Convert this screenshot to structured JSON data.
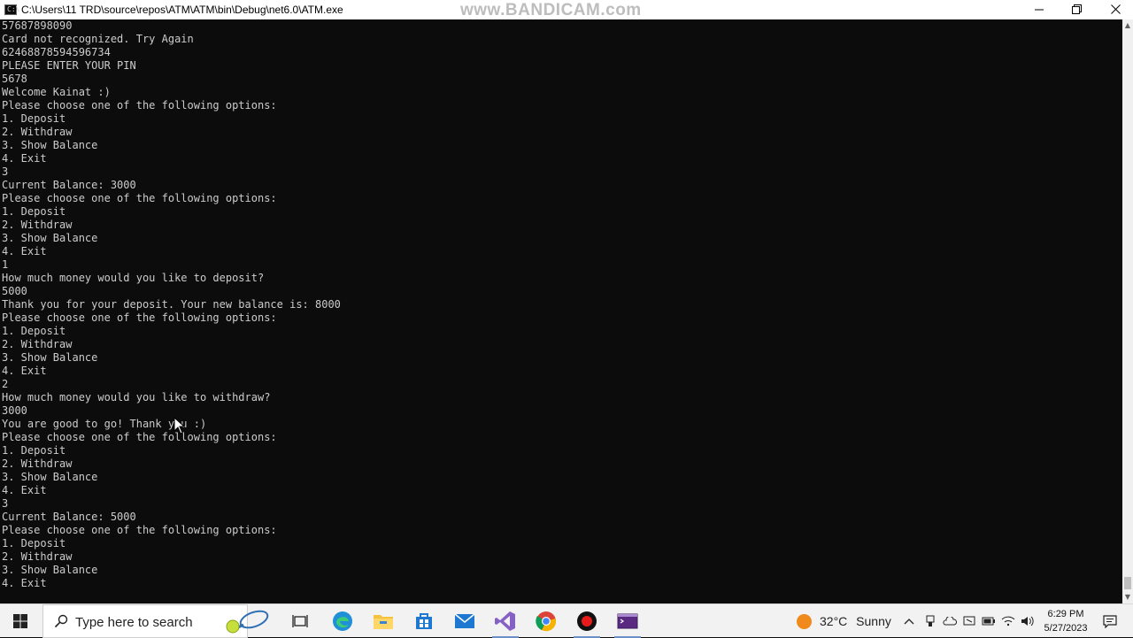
{
  "window": {
    "title": "C:\\Users\\11 TRD\\source\\repos\\ATM\\ATM\\bin\\Debug\\net6.0\\ATM.exe",
    "watermark": "www.BANDICAM.com",
    "minimize_icon": "minimize-icon",
    "restore_icon": "restore-icon",
    "close_icon": "close-icon"
  },
  "console": {
    "lines": [
      "57687898090",
      "Card not recognized. Try Again",
      "62468878594596734",
      "PLEASE ENTER YOUR PIN",
      "5678",
      "Welcome Kainat :)",
      "Please choose one of the following options:",
      "1. Deposit",
      "2. Withdraw",
      "3. Show Balance",
      "4. Exit",
      "3",
      "Current Balance: 3000",
      "Please choose one of the following options:",
      "1. Deposit",
      "2. Withdraw",
      "3. Show Balance",
      "4. Exit",
      "1",
      "How much money would you like to deposit?",
      "5000",
      "Thank you for your deposit. Your new balance is: 8000",
      "Please choose one of the following options:",
      "1. Deposit",
      "2. Withdraw",
      "3. Show Balance",
      "4. Exit",
      "2",
      "How much money would you like to withdraw?",
      "3000",
      "You are good to go! Thank you :)",
      "Please choose one of the following options:",
      "1. Deposit",
      "2. Withdraw",
      "3. Show Balance",
      "4. Exit",
      "3",
      "Current Balance: 5000",
      "Please choose one of the following options:",
      "1. Deposit",
      "2. Withdraw",
      "3. Show Balance",
      "4. Exit"
    ],
    "text_color": "#cccccc",
    "background": "#0c0c0c"
  },
  "taskbar": {
    "search_placeholder": "Type here to search",
    "weather_temp": "32°C",
    "weather_condition": "Sunny",
    "time": "6:29 PM",
    "date": "5/27/2023",
    "pinned": [
      "windows-start-icon",
      "task-view-icon",
      "edge-icon",
      "file-explorer-icon",
      "store-icon",
      "mail-icon",
      "visual-studio-icon",
      "chrome-icon",
      "bandicam-record-icon",
      "terminal-icon"
    ],
    "accent": "#0078d7"
  }
}
